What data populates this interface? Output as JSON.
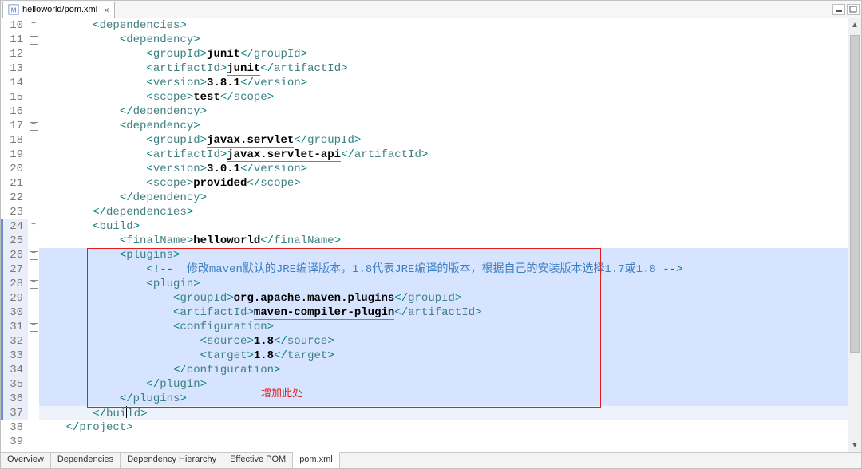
{
  "tab": {
    "title": "helloworld/pom.xml"
  },
  "window_buttons": {
    "min": "—",
    "max": "❐"
  },
  "annotation": {
    "label": "增加此处"
  },
  "comment_text": "修改maven默认的JRE编译版本，1.8代表JRE编译的版本，根据自己的安装版本选择1.7或1.8",
  "lines": [
    {
      "n": 10,
      "fold": "minus",
      "indent": 2,
      "kind": "open",
      "tag": "dependencies"
    },
    {
      "n": 11,
      "fold": "minus",
      "indent": 3,
      "kind": "open",
      "tag": "dependency"
    },
    {
      "n": 12,
      "fold": "",
      "indent": 4,
      "kind": "leaf",
      "tag": "groupId",
      "text": "junit",
      "underline": true
    },
    {
      "n": 13,
      "fold": "",
      "indent": 4,
      "kind": "leaf",
      "tag": "artifactId",
      "text": "junit",
      "underline": true
    },
    {
      "n": 14,
      "fold": "",
      "indent": 4,
      "kind": "leaf",
      "tag": "version",
      "text": "3.8.1"
    },
    {
      "n": 15,
      "fold": "",
      "indent": 4,
      "kind": "leaf",
      "tag": "scope",
      "text": "test"
    },
    {
      "n": 16,
      "fold": "",
      "indent": 3,
      "kind": "close",
      "tag": "dependency"
    },
    {
      "n": 17,
      "fold": "minus",
      "indent": 3,
      "kind": "open",
      "tag": "dependency"
    },
    {
      "n": 18,
      "fold": "",
      "indent": 4,
      "kind": "leaf",
      "tag": "groupId",
      "text": "javax.servlet",
      "underline": true
    },
    {
      "n": 19,
      "fold": "",
      "indent": 4,
      "kind": "leaf",
      "tag": "artifactId",
      "text": "javax.servlet-api",
      "underline": true
    },
    {
      "n": 20,
      "fold": "",
      "indent": 4,
      "kind": "leaf",
      "tag": "version",
      "text": "3.0.1"
    },
    {
      "n": 21,
      "fold": "",
      "indent": 4,
      "kind": "leaf",
      "tag": "scope",
      "text": "provided"
    },
    {
      "n": 22,
      "fold": "",
      "indent": 3,
      "kind": "close",
      "tag": "dependency"
    },
    {
      "n": 23,
      "fold": "",
      "indent": 2,
      "kind": "close",
      "tag": "dependencies"
    },
    {
      "n": 24,
      "fold": "minus",
      "indent": 2,
      "kind": "open",
      "tag": "build",
      "hl": true
    },
    {
      "n": 25,
      "fold": "",
      "indent": 3,
      "kind": "leaf",
      "tag": "finalName",
      "text": "helloworld",
      "hl": true
    },
    {
      "n": 26,
      "fold": "minus",
      "indent": 3,
      "kind": "open",
      "tag": "plugins",
      "hl": true,
      "sel": true
    },
    {
      "n": 27,
      "fold": "",
      "indent": 4,
      "kind": "comment",
      "hl": true,
      "sel": true
    },
    {
      "n": 28,
      "fold": "minus",
      "indent": 4,
      "kind": "open",
      "tag": "plugin",
      "hl": true,
      "sel": true
    },
    {
      "n": 29,
      "fold": "",
      "indent": 5,
      "kind": "leaf",
      "tag": "groupId",
      "text": "org.apache.maven.plugins",
      "underline": true,
      "hl": true,
      "sel": true
    },
    {
      "n": 30,
      "fold": "",
      "indent": 5,
      "kind": "leaf",
      "tag": "artifactId",
      "text": "maven-compiler-plugin",
      "underline": true,
      "hl": true,
      "sel": true
    },
    {
      "n": 31,
      "fold": "minus",
      "indent": 5,
      "kind": "open",
      "tag": "configuration",
      "hl": true,
      "sel": true
    },
    {
      "n": 32,
      "fold": "",
      "indent": 6,
      "kind": "leaf",
      "tag": "source",
      "text": "1.8",
      "hl": true,
      "sel": true
    },
    {
      "n": 33,
      "fold": "",
      "indent": 6,
      "kind": "leaf",
      "tag": "target",
      "text": "1.8",
      "hl": true,
      "sel": true
    },
    {
      "n": 34,
      "fold": "",
      "indent": 5,
      "kind": "close",
      "tag": "configuration",
      "hl": true,
      "sel": true
    },
    {
      "n": 35,
      "fold": "",
      "indent": 4,
      "kind": "close",
      "tag": "plugin",
      "hl": true,
      "sel": true
    },
    {
      "n": 36,
      "fold": "",
      "indent": 3,
      "kind": "close",
      "tag": "plugins",
      "hl": true,
      "sel": true
    },
    {
      "n": 37,
      "fold": "",
      "indent": 2,
      "kind": "close",
      "tag": "build",
      "hl": true,
      "cursor": true
    },
    {
      "n": 38,
      "fold": "",
      "indent": 1,
      "kind": "close",
      "tag": "project"
    },
    {
      "n": 39,
      "fold": "",
      "indent": 0,
      "kind": "blank"
    }
  ],
  "bottom_tabs": {
    "items": [
      "Overview",
      "Dependencies",
      "Dependency Hierarchy",
      "Effective POM",
      "pom.xml"
    ],
    "active": 4
  }
}
